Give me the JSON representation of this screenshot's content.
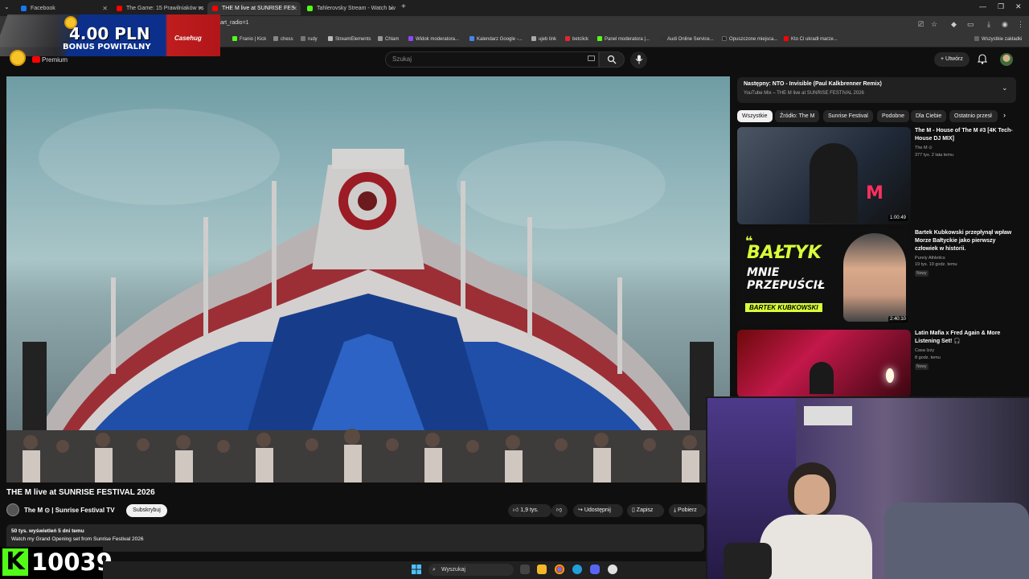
{
  "browser": {
    "tabs": [
      {
        "label": "Facebook",
        "color": "#1877f2"
      },
      {
        "label": "The Game: 15 Prawilniaków vs",
        "color": "#ff0000"
      },
      {
        "label": "THE M live at SUNRISE FES",
        "color": "#ff0000"
      },
      {
        "label": "Tahlerovsky Stream - Watch Liv",
        "color": "#53fc18"
      }
    ],
    "new_tab_label": "+",
    "url": "tart_radio=1",
    "bookmarks": [
      "Franio | Kick",
      "chess",
      "rudy",
      "StreamElements",
      "Chlam",
      "Widok moderatora...",
      "Kalendarz Google -...",
      "ujeb link",
      "betclick",
      "Panel moderatora |...",
      "Audi Online Service...",
      "Opuszczone miejsca...",
      "Kto Ci ukradł marze..."
    ],
    "all_bookmarks": "Wszystkie zakładki"
  },
  "header": {
    "premium": "Premium",
    "search_placeholder": "Szukaj",
    "create_label": "Utwórz"
  },
  "video": {
    "title": "THE M live at SUNRISE FESTIVAL 2026",
    "channel": "The M ⊙ | Sunrise Festival TV",
    "subscribe": "Subskrybuj",
    "likes": "1,9 tys.",
    "share": "Udostępnij",
    "save": "Zapisz",
    "download": "Pobierz",
    "views": "50 tys. wyświetleń  5 dni temu",
    "description": "Watch my Grand Opening set from Sunrise Festival 2026"
  },
  "next_up": {
    "title": "Następny: NTO - Invisible (Paul Kalkbrenner Remix)",
    "subtitle": "YouTube Mix – THE M live at SUNRISE FESTIVAL 2026"
  },
  "chips": [
    "Wszystkie",
    "Źródło: The M",
    "Sunrise Festival",
    "Podobne",
    "Dla Ciebie",
    "Ostatnio przesł"
  ],
  "recommendations": [
    {
      "title": "The M - House of The M #3 [4K Tech-House DJ MIX]",
      "channel": "The M ⊙",
      "meta": "377 tys.  2 lata temu",
      "duration": "1:00:49",
      "badge": ""
    },
    {
      "title": "Bartek Kubkowski przepłynął wpław Morze Bałtyckie jako pierwszy człowiek w historii.",
      "channel": "Purely Athletics",
      "meta": "19 tys.  19 godz. temu",
      "duration": "2:40:10",
      "badge": "Nowy",
      "thumb_text": {
        "line1": "BAŁTYK",
        "line2": "MNIE",
        "line3": "PRZEPUŚCIŁ",
        "name": "BARTEK KUBKOWSKI"
      }
    },
    {
      "title": "Latin Mafia x Fred Again & More Listening Set! 🎧",
      "channel": "Casa Izzy",
      "meta": "8 godz. temu",
      "duration": "",
      "badge": "Nowy"
    }
  ],
  "overlay": {
    "promo_amount": "4.00 PLN",
    "promo_bonus": "BONUS POWITALNY",
    "promo_brand": "Casehug",
    "kick_count": "10039",
    "kick_logo": "K"
  },
  "taskbar": {
    "search": "Wyszukaj"
  },
  "colors": {
    "youtube_red": "#ff0000",
    "kick_green": "#53fc18",
    "background": "#0f0f0f"
  }
}
